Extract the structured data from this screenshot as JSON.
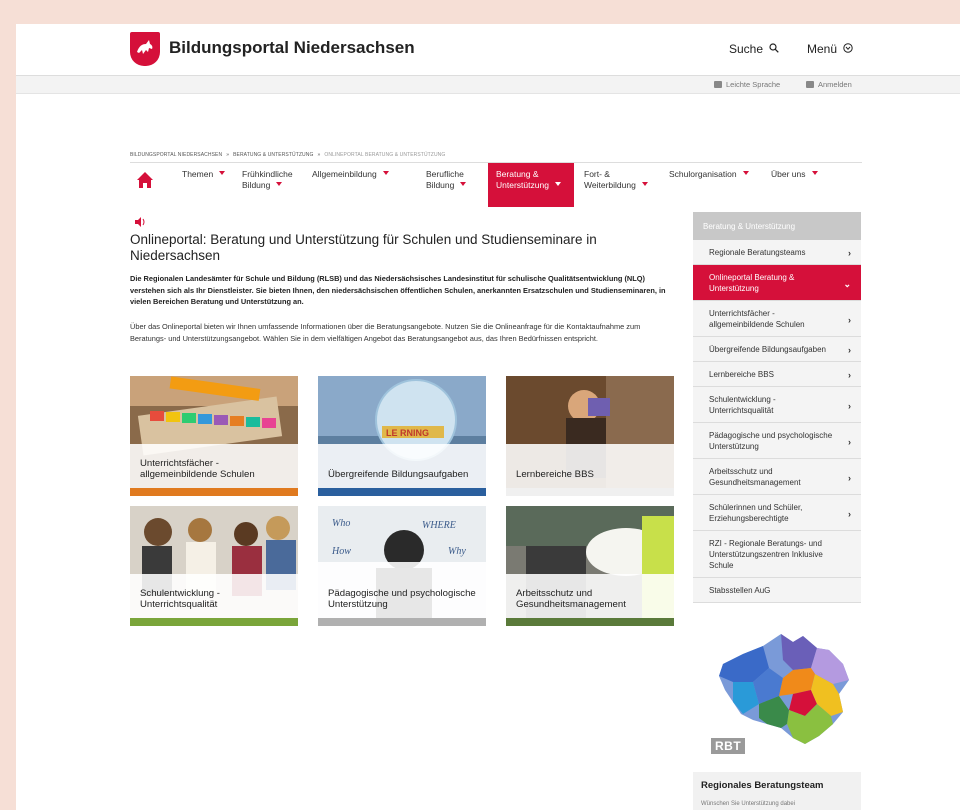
{
  "header": {
    "site_title": "Bildungsportal Niedersachsen",
    "search_label": "Suche",
    "menu_label": "Menü",
    "easy_language_label": "Leichte Sprache",
    "login_label": "Anmelden"
  },
  "breadcrumb": {
    "items": [
      "BILDUNGSPORTAL NIEDERSACHSEN",
      "BERATUNG & UNTERSTÜTZUNG",
      "ONLINEPORTAL BERATUNG & UNTERSTÜTZUNG"
    ],
    "separator": "»"
  },
  "nav": {
    "items": [
      {
        "label": "Themen"
      },
      {
        "label": "Frühkindliche Bildung"
      },
      {
        "label": "Allgemeinbildung"
      },
      {
        "label": "Berufliche Bildung"
      },
      {
        "label": "Beratung & Unterstützung"
      },
      {
        "label": "Fort- & Weiterbildung"
      },
      {
        "label": "Schulorganisation"
      },
      {
        "label": "Über uns"
      }
    ]
  },
  "main": {
    "title": "Onlineportal: Beratung und Unterstützung für Schulen und Studienseminare in Niedersachsen",
    "lead": "Die Regionalen Landesämter für Schule und Bildung (RLSB) und das Niedersächsisches Landesinstitut für schulische Qualitätsentwicklung (NLQ) verstehen sich als Ihr Dienstleister. Sie bieten Ihnen, den niedersächsischen öffentlichen Schulen, anerkannten Ersatzschulen und Studienseminaren, in vielen Bereichen Beratung und Unterstützung an.",
    "body": "Über das Onlineportal bieten wir Ihnen umfassende Informationen über die Beratungsangebote. Nutzen Sie die Onlineanfrage für die Kontaktaufnahme zum Beratungs- und Unterstützungsangebot. Wählen Sie in dem vielfältigen Angebot das Beratungsangebot aus, das Ihren Bedürfnissen entspricht.",
    "tiles": [
      {
        "label": "Unterrichtsfächer - allgemeinbildende Schulen",
        "bar_color": "#e07a1f"
      },
      {
        "label": "Übergreifende Bildungsaufgaben",
        "bar_color": "#2a5f9e"
      },
      {
        "label": "Lernbereiche BBS",
        "bar_color": "#ffffff"
      },
      {
        "label": "Schulentwicklung - Unterrichtsqualität",
        "bar_color": "#7aa53a"
      },
      {
        "label": "Pädagogische und psychologische Unterstützung",
        "bar_color": "#b0b0b0"
      },
      {
        "label": "Arbeitsschutz und Gesundheitsmanagement",
        "bar_color": "#5a7a3a"
      }
    ]
  },
  "sidebar": {
    "heading": "Beratung & Unterstützung",
    "items": [
      {
        "label": "Regionale Beratungsteams"
      },
      {
        "label": "Onlineportal Beratung & Unterstützung"
      },
      {
        "label": "Unterrichtsfächer - allgemeinbildende Schulen"
      },
      {
        "label": "Übergreifende Bildungsaufgaben"
      },
      {
        "label": "Lernbereiche BBS"
      },
      {
        "label": "Schulentwicklung - Unterrichtsqualität"
      },
      {
        "label": "Pädagogische und psychologische Unterstützung"
      },
      {
        "label": "Arbeitsschutz und Gesundheitsmanagement"
      },
      {
        "label": "Schülerinnen und Schüler, Erziehungsberechtigte"
      },
      {
        "label": "RZI - Regionale Beratungs- und Unterstützungszentren Inklusive Schule"
      },
      {
        "label": "Stabsstellen AuG"
      }
    ],
    "map_badge": "RBT",
    "team_title": "Regionales Beratungsteam",
    "team_subtitle": "Wünschen Sie Unterstützung dabei"
  },
  "colors": {
    "accent": "#d5103a",
    "page_background": "#f6dfd6",
    "sidebar_head": "#c8c8c8"
  }
}
